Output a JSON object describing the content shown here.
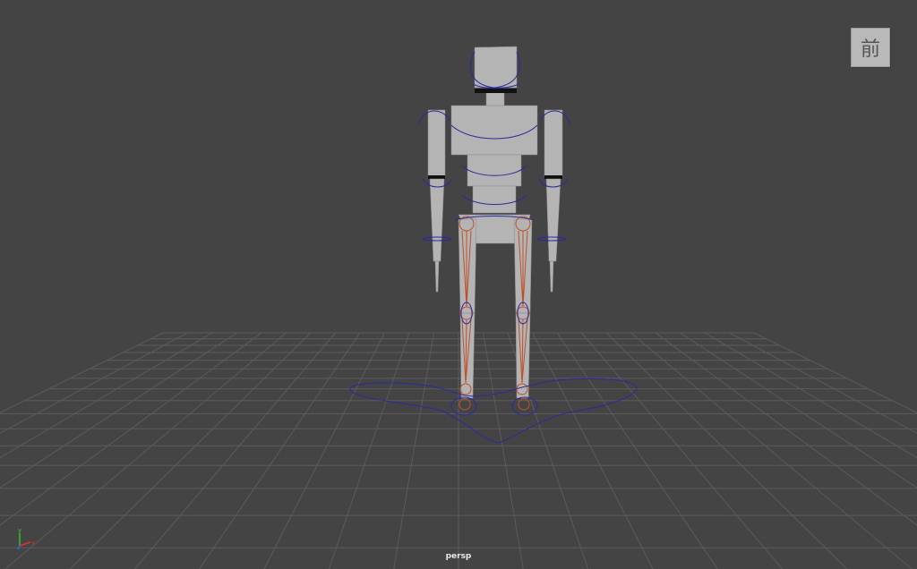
{
  "viewport": {
    "camera_name": "persp",
    "view_cube_face": "前",
    "background_color": "#444444",
    "grid_color": "#5b5b5b"
  },
  "axis_gizmo": {
    "x_label": "x",
    "y_label": "y",
    "x_color": "#e03030",
    "y_color": "#30c030",
    "z_color": "#3060e0"
  },
  "scene": {
    "mesh_color": "#b4b4b4",
    "control_curve_color": "#2a2aa0",
    "joint_color": "#c0502a"
  }
}
